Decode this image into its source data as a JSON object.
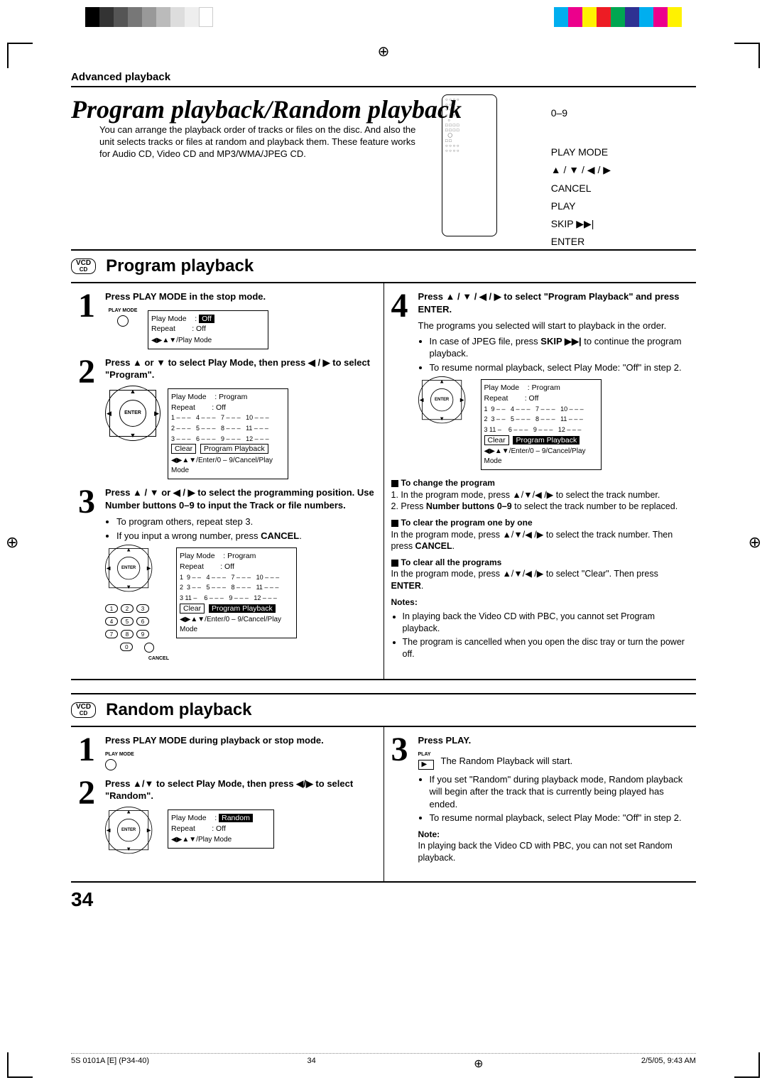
{
  "header": {
    "breadcrumb": "Advanced playback"
  },
  "title": "Program playback/Random playback",
  "intro": "You can arrange the playback order of tracks or files on the disc. And also the unit selects tracks or files at random and playback them. These feature works for Audio CD, Video CD and MP3/WMA/JPEG CD.",
  "remoteLabels": {
    "numbers": "0–9",
    "playmode": "PLAY MODE",
    "arrows": "▲ / ▼ / ◀ / ▶",
    "cancel": "CANCEL",
    "play": "PLAY",
    "skip": "SKIP ▶▶|",
    "enter": "ENTER"
  },
  "disc": {
    "top": "VCD",
    "bottom": "CD"
  },
  "section1": "Program playback",
  "pp": {
    "s1": {
      "head": "Press PLAY MODE in the stop mode.",
      "iconLabel": "PLAY MODE",
      "panel": {
        "l1": "Play Mode",
        "v1": "Off",
        "l2": "Repeat",
        "v2": "Off",
        "hint": "◀▶▲▼/Play Mode"
      }
    },
    "s2": {
      "head": "Press ▲ or ▼ to select Play Mode, then press ◀ / ▶ to select \"Program\".",
      "panel": {
        "l1": "Play Mode",
        "v1": "Program",
        "l2": "Repeat",
        "v2": "Off",
        "rows": "1 – – –   4 – – –   7 – – –   10 – – –\n2 – – –   5 – – –   8 – – –   11 – – –\n3 – – –   6 – – –   9 – – –   12 – – –",
        "clear": "Clear",
        "pp": "Program Playback",
        "hint": "◀▶▲▼/Enter/0 – 9/Cancel/Play Mode"
      }
    },
    "s3": {
      "head": "Press ▲ / ▼ or ◀ / ▶ to select the programming position. Use Number buttons 0–9 to input the Track or file numbers.",
      "b1": "To program others, repeat step 3.",
      "b2": "If you input a wrong number, press",
      "cancel": "CANCEL",
      "cancelSmall": "CANCEL",
      "panel": {
        "l1": "Play Mode",
        "v1": "Program",
        "l2": "Repeat",
        "v2": "Off",
        "rows": "1  9 – –   4 – – –   7 – – –   10 – – –\n2  3 – –   5 – – –   8 – – –   11 – – –\n3 11 –    6 – – –   9 – – –   12 – – –",
        "clear": "Clear",
        "pp": "Program Playback",
        "hint": "◀▶▲▼/Enter/0 – 9/Cancel/Play Mode"
      }
    },
    "s4": {
      "head": "Press ▲ / ▼ / ◀ / ▶ to select \"Program Playback\" and press ENTER.",
      "p1": "The programs you selected will start to playback in the order.",
      "b1a": "In case of JPEG file, press ",
      "b1bold": "SKIP ▶▶|",
      "b1b": " to continue the program playback.",
      "b2": "To resume normal playback, select Play Mode: \"Off\" in step 2.",
      "panel": {
        "l1": "Play Mode",
        "v1": "Program",
        "l2": "Repeat",
        "v2": "Off",
        "rows": "1  9 – –   4 – – –   7 – – –   10 – – –\n2  3 – –   5 – – –   8 – – –   11 – – –\n3 11 –    6 – – –   9 – – –   12 – – –",
        "clear": "Clear",
        "pp": "Program Playback",
        "hint": "◀▶▲▼/Enter/0 – 9/Cancel/Play Mode"
      }
    },
    "change": {
      "title": "To change the program",
      "l1a": "In the program mode, press ▲/▼/◀ /▶ to select the track number.",
      "l2a": "Press ",
      "l2b": "Number buttons 0–9",
      "l2c": " to select the track number to be replaced."
    },
    "clearOne": {
      "title": "To clear the program one by one",
      "text": "In the program mode, press ▲/▼/◀ /▶ to select the track number. Then press ",
      "bold": "CANCEL",
      "tail": "."
    },
    "clearAll": {
      "title": "To clear all the programs",
      "text": "In the program mode, press ▲/▼/◀ /▶ to select \"Clear\". Then press ",
      "bold": "ENTER",
      "tail": "."
    },
    "notesHead": "Notes:",
    "n1": "In playing back the Video CD with PBC, you cannot set Program playback.",
    "n2": "The program is cancelled when you open the disc tray or turn the power off."
  },
  "section2": "Random playback",
  "rp": {
    "s1": {
      "head": "Press PLAY MODE during playback or stop mode.",
      "iconLabel": "PLAY MODE"
    },
    "s2": {
      "head": "Press ▲/▼ to select Play Mode, then press ◀/▶ to select \"Random\".",
      "panel": {
        "l1": "Play Mode",
        "v1": "Random",
        "l2": "Repeat",
        "v2": "Off",
        "hint": "◀▶▲▼/Play Mode"
      }
    },
    "s3": {
      "head": "Press PLAY.",
      "iconLabel": "PLAY",
      "text": "The Random Playback will start.",
      "b1": "If you set \"Random\" during playback mode, Random playback will begin after the track that is currently being played has ended.",
      "b2": "To resume normal playback, select Play Mode: \"Off\" in step 2."
    },
    "noteHead": "Note:",
    "note": "In playing back the Video CD with PBC, you can not set Random playback."
  },
  "pageNum": "34",
  "footer": {
    "left": "5S 0101A [E] (P34-40)",
    "mid": "34",
    "right": "2/5/05, 9:43 AM"
  },
  "nums": [
    "1",
    "2",
    "3",
    "4",
    "5",
    "6",
    "7",
    "8",
    "9",
    "0"
  ],
  "enterLabel": "ENTER"
}
